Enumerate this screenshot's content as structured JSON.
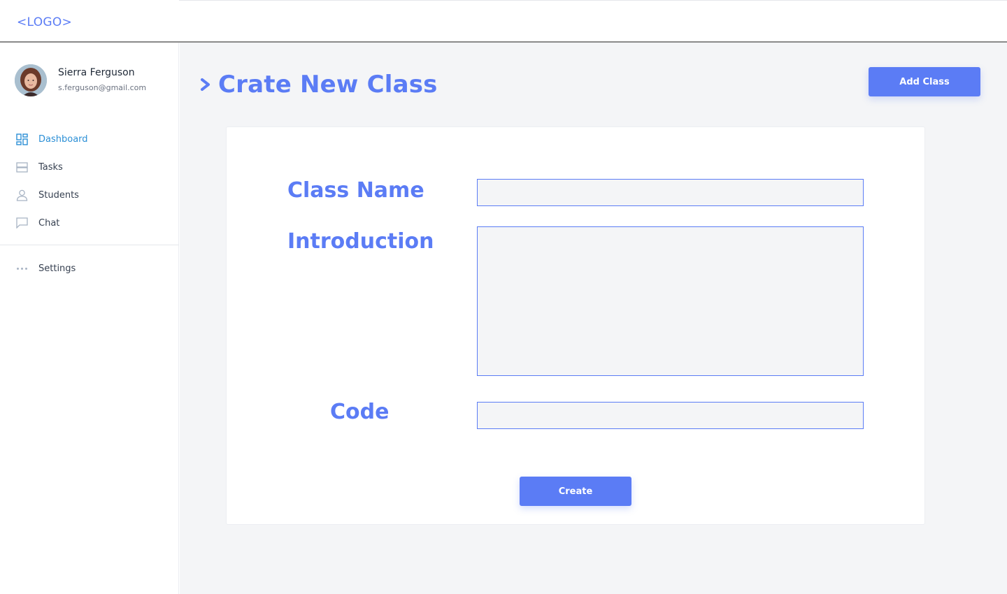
{
  "app": {
    "logo_text": "<LOGO>"
  },
  "profile": {
    "name": "Sierra Ferguson",
    "email": "s.ferguson@gmail.com"
  },
  "sidebar": {
    "items": [
      {
        "label": "Dashboard",
        "icon": "dashboard-icon",
        "active": true
      },
      {
        "label": "Tasks",
        "icon": "tasks-icon",
        "active": false
      },
      {
        "label": "Students",
        "icon": "user-icon",
        "active": false
      },
      {
        "label": "Chat",
        "icon": "chat-icon",
        "active": false
      }
    ],
    "settings": {
      "label": "Settings",
      "icon": "more-dots-icon"
    }
  },
  "main": {
    "title": "Crate New Class",
    "add_button_label": "Add Class",
    "form": {
      "class_name_label": "Class Name",
      "class_name_value": "",
      "introduction_label": "Introduction",
      "introduction_value": "",
      "code_label": "Code",
      "code_value": "",
      "submit_label": "Create"
    }
  },
  "colors": {
    "accent": "#5b7cf5",
    "active_nav": "#2b8fd6",
    "background": "#f4f5f7"
  }
}
